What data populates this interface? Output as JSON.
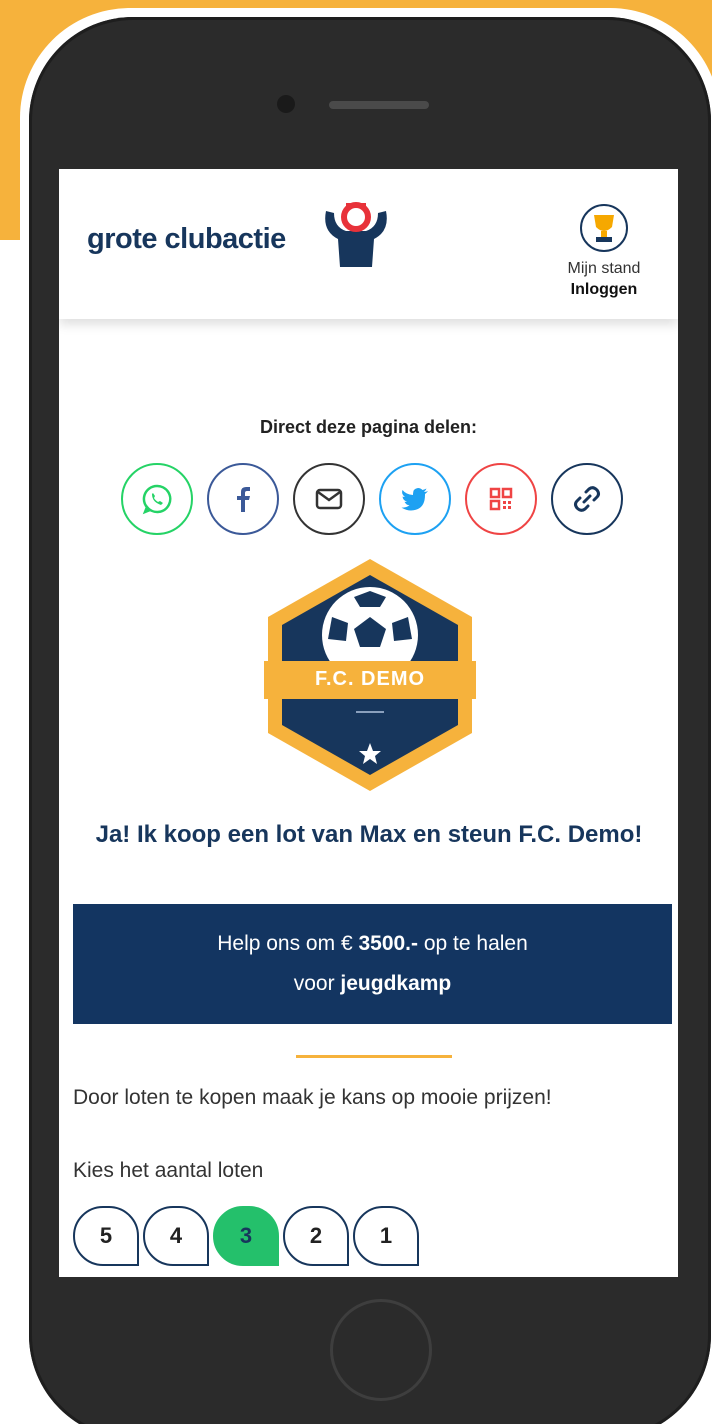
{
  "header": {
    "logo_text": "grote clubactie",
    "stand_label": "Mijn stand",
    "login_label": "Inloggen"
  },
  "share": {
    "title": "Direct deze pagina delen:",
    "buttons": [
      {
        "name": "whatsapp",
        "color": "#25d366"
      },
      {
        "name": "facebook",
        "color": "#3b5998"
      },
      {
        "name": "email",
        "color": "#333333"
      },
      {
        "name": "twitter",
        "color": "#1da1f2"
      },
      {
        "name": "qr-code",
        "color": "#ef4444"
      },
      {
        "name": "link",
        "color": "#17365c"
      }
    ]
  },
  "club": {
    "badge_name": "F.C. DEMO"
  },
  "cta": {
    "title": "Ja! Ik koop een lot van Max en steun F.C. Demo!"
  },
  "goal": {
    "prefix": "Help ons om € ",
    "amount": "3500.-",
    "middle": " op te halen",
    "for_label": "voor ",
    "purpose": "jeugdkamp"
  },
  "description": "Door loten te kopen maak je kans op mooie prijzen!",
  "quantity": {
    "label": "Kies het aantal loten",
    "options": [
      "5",
      "4",
      "3",
      "2",
      "1"
    ],
    "selected": "3"
  },
  "colors": {
    "brand_navy": "#133561",
    "brand_orange": "#f6b23c",
    "accent_green": "#24c06b"
  }
}
